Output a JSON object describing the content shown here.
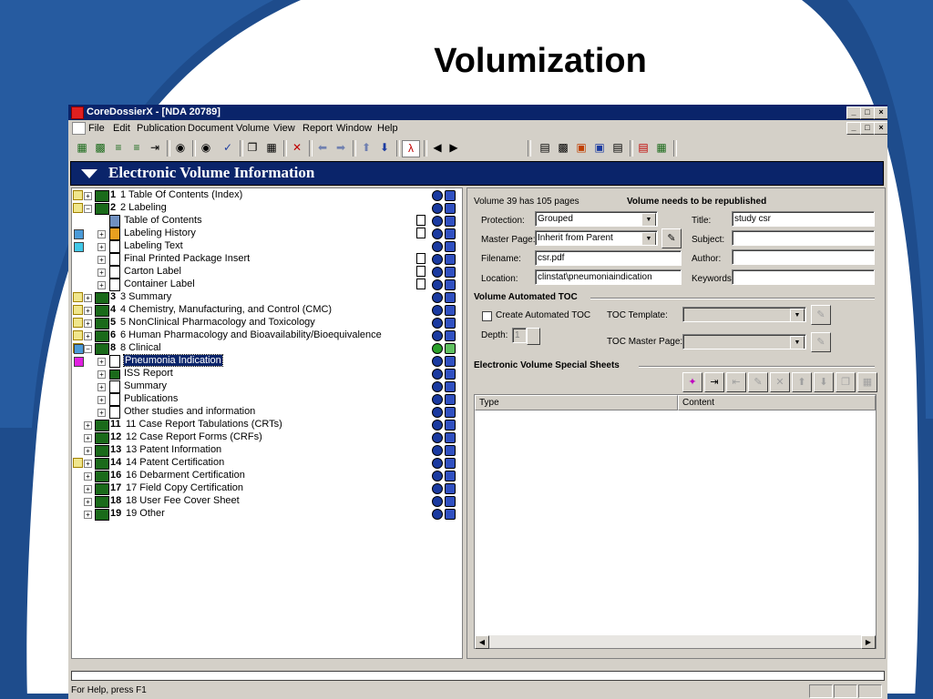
{
  "slide": {
    "title": "Volumization"
  },
  "window": {
    "title": "CoreDossierX - [NDA 20789]",
    "buttons": [
      "_",
      "□",
      "×"
    ]
  },
  "menu": [
    "File",
    "Edit",
    "Publication",
    "Document",
    "Volume",
    "View",
    "Report",
    "Window",
    "Help"
  ],
  "section_header": "Electronic Volume Information",
  "tree": [
    {
      "num": "1",
      "label": "1 Table Of Contents (Index)"
    },
    {
      "num": "2",
      "label": "2 Labeling"
    },
    {
      "label": "Table of Contents"
    },
    {
      "label": "Labeling History"
    },
    {
      "label": "Labeling Text"
    },
    {
      "label": "Final Printed Package Insert"
    },
    {
      "label": "Carton Label"
    },
    {
      "label": "Container Label"
    },
    {
      "num": "3",
      "label": "3 Summary"
    },
    {
      "num": "4",
      "label": "4 Chemistry, Manufacturing, and Control  (CMC)"
    },
    {
      "num": "5",
      "label": "5 NonClinical Pharmacology and Toxicology"
    },
    {
      "num": "6",
      "label": "6 Human Pharmacology and Bioavailability/Bioequivalence"
    },
    {
      "num": "8",
      "label": "8 Clinical"
    },
    {
      "label": "Pneumonia Indication"
    },
    {
      "label": "ISS Report"
    },
    {
      "label": "Summary"
    },
    {
      "label": "Publications"
    },
    {
      "label": "Other studies and information"
    },
    {
      "num": "11",
      "label": "11 Case Report Tabulations (CRTs)"
    },
    {
      "num": "12",
      "label": "12 Case Report Forms (CRFs)"
    },
    {
      "num": "13",
      "label": "13 Patent Information"
    },
    {
      "num": "14",
      "label": "14 Patent Certification"
    },
    {
      "num": "16",
      "label": "16 Debarment Certification"
    },
    {
      "num": "17",
      "label": "17 Field Copy Certification"
    },
    {
      "num": "18",
      "label": "18 User Fee Cover Sheet"
    },
    {
      "num": "19",
      "label": "19 Other"
    }
  ],
  "details": {
    "info": "Volume 39 has 105 pages",
    "warning": "Volume needs to be republished",
    "protection_label": "Protection:",
    "protection_value": "Grouped",
    "master_page_label": "Master Page:",
    "master_page_value": "Inherit from Parent",
    "filename_label": "Filename:",
    "filename_value": "csr.pdf",
    "location_label": "Location:",
    "location_value": "clinstat\\pneumoniaindication",
    "title_label": "Title:",
    "title_value": "study csr",
    "subject_label": "Subject:",
    "subject_value": "",
    "author_label": "Author:",
    "author_value": "",
    "keywords_label": "Keywords:",
    "keywords_value": ""
  },
  "toc": {
    "group_title": "Volume Automated TOC",
    "create_label": "Create Automated TOC",
    "create_checked": false,
    "depth_label": "Depth:",
    "depth_value": "1",
    "template_label": "TOC Template:",
    "master_page_label": "TOC Master Page:"
  },
  "special_sheets": {
    "group_title": "Electronic Volume Special Sheets",
    "columns": [
      "Type",
      "Content"
    ]
  },
  "status": {
    "text": "For Help, press F1"
  },
  "colors": {
    "titlebar": "#0a246a",
    "section": "#0a246a",
    "face": "#d4d0c8",
    "selection": "#0a246a"
  }
}
